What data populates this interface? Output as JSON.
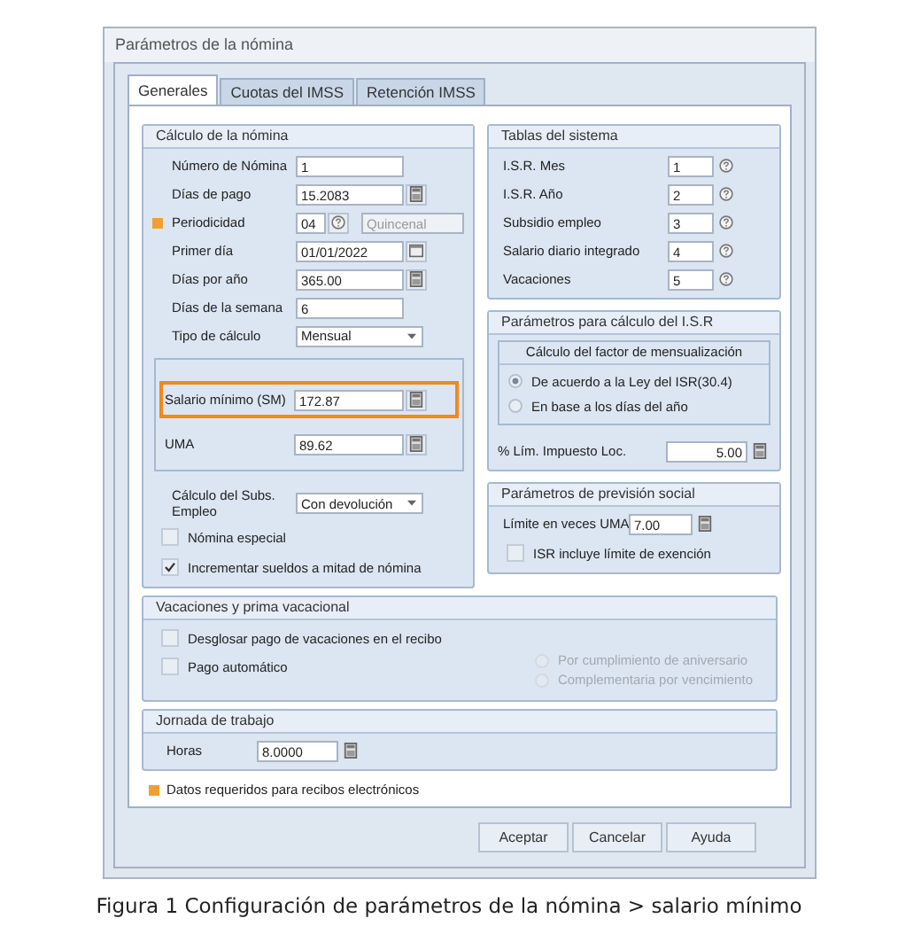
{
  "window": {
    "title": "Parámetros de la nómina"
  },
  "tabs": [
    {
      "label": "Generales",
      "selected": true
    },
    {
      "label": "Cuotas del IMSS",
      "selected": false
    },
    {
      "label": "Retención IMSS",
      "selected": false
    }
  ],
  "calculo": {
    "title": "Cálculo de la nómina",
    "fields": [
      {
        "kind": "text",
        "label": "Número de Nómina",
        "value": "1",
        "required": false
      },
      {
        "kind": "calc",
        "label": "Días de pago",
        "value": "15.2083",
        "required": false
      },
      {
        "kind": "lookup",
        "label": "Periodicidad",
        "value": "04",
        "extra": "Quincenal",
        "required": true
      },
      {
        "kind": "date",
        "label": "Primer día",
        "value": "01/01/2022",
        "required": false
      },
      {
        "kind": "calc",
        "label": "Días por año",
        "value": "365.00",
        "required": false
      },
      {
        "kind": "text",
        "label": "Días de la semana",
        "value": "6",
        "required": false
      },
      {
        "kind": "select",
        "label": "Tipo de cálculo",
        "value": "Mensual",
        "required": false
      }
    ],
    "wage_fields": [
      {
        "label": "Salario mínimo (SM)",
        "value": "172.87",
        "highlighted": true
      },
      {
        "label": "UMA",
        "value": "89.62",
        "highlighted": false
      }
    ],
    "subsidio": {
      "label": "Cálculo del Subs. Empleo",
      "value": "Con devolución"
    },
    "checks": [
      {
        "label": "Nómina especial",
        "checked": false
      },
      {
        "label": "Incrementar sueldos a mitad de nómina",
        "checked": true
      }
    ]
  },
  "tablas": {
    "title": "Tablas del sistema",
    "rows": [
      {
        "label": "I.S.R. Mes",
        "value": "1"
      },
      {
        "label": "I.S.R. Año",
        "value": "2"
      },
      {
        "label": "Subsidio empleo",
        "value": "3"
      },
      {
        "label": "Salario diario integrado",
        "value": "4"
      },
      {
        "label": "Vacaciones",
        "value": "5"
      }
    ]
  },
  "isr": {
    "title": "Parámetros para cálculo del I.S.R",
    "factor_title": "Cálculo del factor de mensualización",
    "radios": [
      {
        "label": "De acuerdo a la Ley del ISR(30.4)",
        "selected": true
      },
      {
        "label": "En base a los días del año",
        "selected": false
      }
    ],
    "limit": {
      "label": "% Lím. Impuesto Loc.",
      "value": "5.00"
    }
  },
  "prevision": {
    "title": "Parámetros de previsión social",
    "limit": {
      "label": "Límite en veces UMA",
      "value": "7.00"
    },
    "check": {
      "label": "ISR incluye límite de exención",
      "checked": false
    }
  },
  "vacaciones": {
    "title": "Vacaciones y prima vacacional",
    "checks": [
      {
        "label": "Desglosar pago de vacaciones en el recibo",
        "checked": false
      },
      {
        "label": "Pago automático",
        "checked": false
      }
    ],
    "radios": [
      {
        "label": "Por cumplimiento de aniversario",
        "selected": false,
        "disabled": true
      },
      {
        "label": "Complementaria por vencimiento",
        "selected": false,
        "disabled": true
      }
    ]
  },
  "jornada": {
    "title": "Jornada de trabajo",
    "label": "Horas",
    "value": "8.0000"
  },
  "legend": "Datos requeridos para recibos electrónicos",
  "buttons": [
    "Aceptar",
    "Cancelar",
    "Ayuda"
  ],
  "caption": "Figura 1 Configuración de parámetros de la nómina > salario mínimo"
}
